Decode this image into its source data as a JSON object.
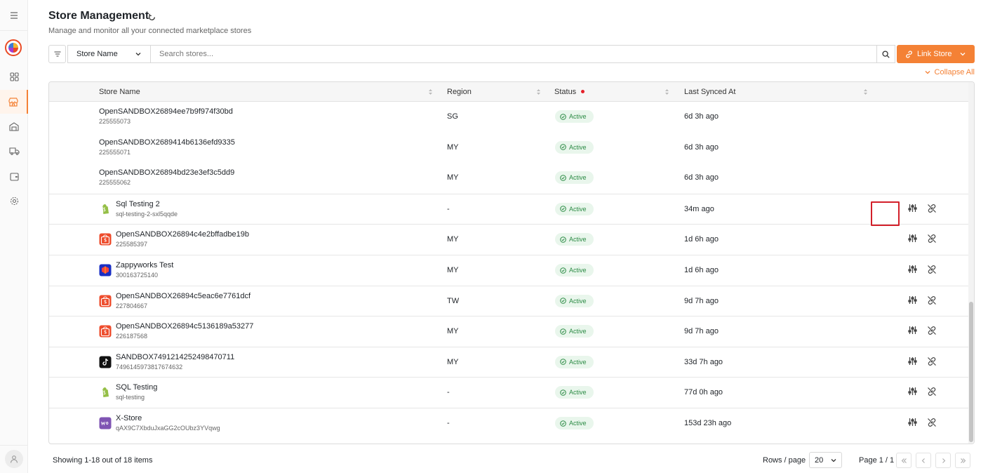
{
  "header": {
    "title": "Store Management",
    "subtitle": "Manage and monitor all your connected marketplace stores"
  },
  "toolbar": {
    "field_select": "Store Name",
    "search_placeholder": "Search stores...",
    "link_store_label": "Link Store",
    "collapse_all_label": "Collapse All"
  },
  "table": {
    "columns": [
      "Store Name",
      "Region",
      "Status",
      "Last Synced At"
    ],
    "status_indicator_color": "#e5202a",
    "child_rows": [
      {
        "name": "OpenSANDBOX26894ee7b9f974f30bd",
        "id": "225555073",
        "region": "SG",
        "status": "Active",
        "synced": "6d 3h ago"
      },
      {
        "name": "OpenSANDBOX2689414b6136efd9335",
        "id": "225555071",
        "region": "MY",
        "status": "Active",
        "synced": "6d 3h ago"
      },
      {
        "name": "OpenSANDBOX26894bd23e3ef3c5dd9",
        "id": "225555062",
        "region": "MY",
        "status": "Active",
        "synced": "6d 3h ago"
      }
    ],
    "rows": [
      {
        "name": "Sql Testing 2",
        "id": "sql-testing-2-sxl5qqde",
        "platform": "shopify-icon",
        "region": "-",
        "status": "Active",
        "synced": "34m ago"
      },
      {
        "name": "OpenSANDBOX26894c4e2bffadbe19b",
        "id": "225585397",
        "platform": "shopee-icon",
        "region": "MY",
        "status": "Active",
        "synced": "1d 6h ago"
      },
      {
        "name": "Zappyworks Test",
        "id": "300163725140",
        "platform": "lazada-icon",
        "region": "MY",
        "status": "Active",
        "synced": "1d 6h ago"
      },
      {
        "name": "OpenSANDBOX26894c5eac6e7761dcf",
        "id": "227804667",
        "platform": "shopee-icon",
        "region": "TW",
        "status": "Active",
        "synced": "9d 7h ago"
      },
      {
        "name": "OpenSANDBOX26894c5136189a53277",
        "id": "226187568",
        "platform": "shopee-icon",
        "region": "MY",
        "status": "Active",
        "synced": "9d 7h ago"
      },
      {
        "name": "SANDBOX7491214252498470711",
        "id": "7496145973817674632",
        "platform": "tiktok-icon",
        "region": "MY",
        "status": "Active",
        "synced": "33d 7h ago"
      },
      {
        "name": "SQL Testing",
        "id": "sql-testing",
        "platform": "shopify-icon",
        "region": "-",
        "status": "Active",
        "synced": "77d 0h ago"
      },
      {
        "name": "X-Store",
        "id": "qAX9C7XbduJxaGG2cOUbz3YVqwg",
        "platform": "woo-icon",
        "region": "-",
        "status": "Active",
        "synced": "153d 23h ago"
      }
    ]
  },
  "footer": {
    "showing": "Showing 1-18 out of 18 items",
    "rows_per_page_label": "Rows / page",
    "rows_per_page_value": "20",
    "page_label": "Page 1 / 1"
  },
  "colors": {
    "accent": "#f48135",
    "status_bg": "#e9f6ec",
    "status_text": "#2a8a43",
    "highlight": "#d3202a"
  }
}
